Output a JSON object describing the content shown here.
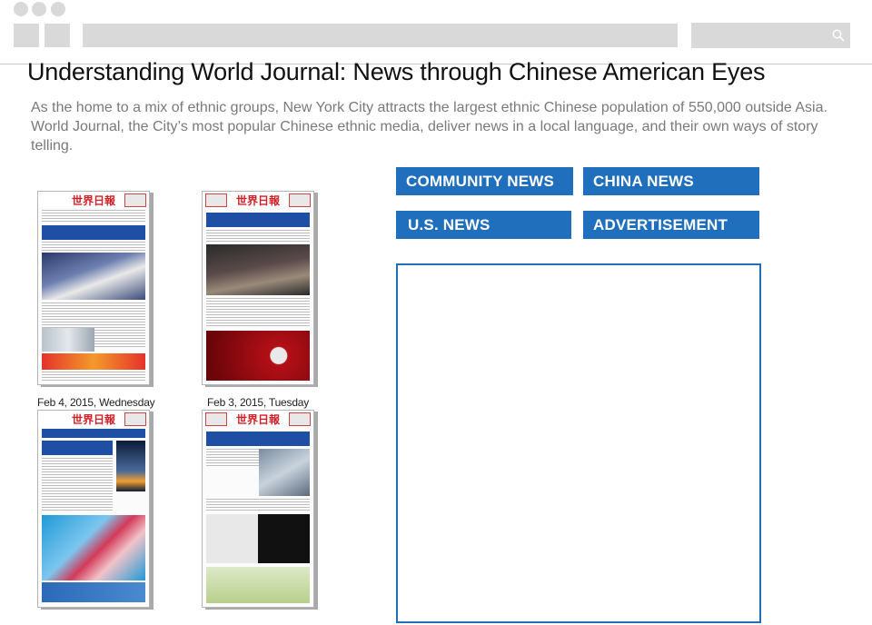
{
  "page": {
    "title": "Understanding World Journal: News through Chinese American Eyes",
    "intro": "As the home to a mix of ethnic groups, New York City attracts the largest ethnic Chinese population of 550,000 outside Asia. World Journal, the City’s most popular Chinese ethnic media, deliver news in a local language, and  their own ways of story telling."
  },
  "colors": {
    "accent": "#1f6fbd",
    "masthead_red": "#d21f26",
    "chrome_gray": "#d9d9d9"
  },
  "chrome": {
    "search_icon": "search-icon"
  },
  "papers": [
    {
      "masthead": "世界日報",
      "date": "Feb 4, 2015, Wednesday"
    },
    {
      "masthead": "世界日報",
      "date": "Feb 3, 2015, Tuesday"
    },
    {
      "masthead": "世界日報",
      "date": ""
    },
    {
      "masthead": "世界日報",
      "date": ""
    }
  ],
  "categories": {
    "community": "COMMUNITY NEWS",
    "china": "CHINA NEWS",
    "us": "U.S. NEWS",
    "advertisement": "ADVERTISEMENT"
  }
}
